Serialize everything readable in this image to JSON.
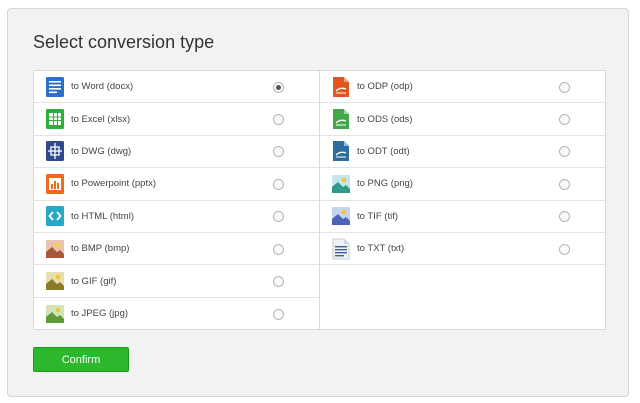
{
  "title": "Select conversion type",
  "confirm_label": "Confirm",
  "colors": {
    "confirm_bg": "#2cb72c",
    "panel_bg": "#f2f2f2"
  },
  "left_options": [
    {
      "label": "to Word (docx)",
      "icon": "word-doc-icon",
      "selected": true
    },
    {
      "label": "to Excel (xlsx)",
      "icon": "excel-sheet-icon",
      "selected": false
    },
    {
      "label": "to DWG (dwg)",
      "icon": "dwg-drawing-icon",
      "selected": false
    },
    {
      "label": "to Powerpoint (pptx)",
      "icon": "powerpoint-icon",
      "selected": false
    },
    {
      "label": "to HTML (html)",
      "icon": "html-code-icon",
      "selected": false
    },
    {
      "label": "to BMP (bmp)",
      "icon": "bmp-image-icon",
      "selected": false
    },
    {
      "label": "to GIF (gif)",
      "icon": "gif-image-icon",
      "selected": false
    },
    {
      "label": "to JPEG (jpg)",
      "icon": "jpeg-image-icon",
      "selected": false
    }
  ],
  "right_options": [
    {
      "label": "to ODP (odp)",
      "icon": "odp-presentation-icon",
      "selected": false
    },
    {
      "label": "to ODS (ods)",
      "icon": "ods-spreadsheet-icon",
      "selected": false
    },
    {
      "label": "to ODT (odt)",
      "icon": "odt-text-icon",
      "selected": false
    },
    {
      "label": "to PNG (png)",
      "icon": "png-image-icon",
      "selected": false
    },
    {
      "label": "to TIF (tif)",
      "icon": "tif-image-icon",
      "selected": false
    },
    {
      "label": "to TXT (txt)",
      "icon": "txt-file-icon",
      "selected": false
    }
  ]
}
